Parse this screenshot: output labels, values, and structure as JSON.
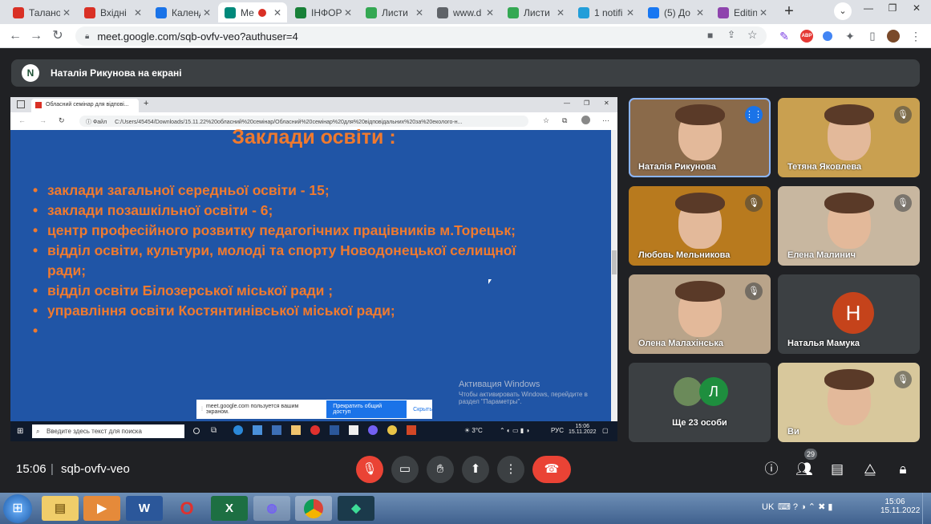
{
  "browser": {
    "tabs": [
      {
        "title": "Талано",
        "favicon": "gmail-icon",
        "color": "#d93025"
      },
      {
        "title": "Вхідні",
        "favicon": "gmail-icon",
        "color": "#d93025"
      },
      {
        "title": "Календ",
        "favicon": "calendar-icon",
        "color": "#1a73e8"
      },
      {
        "title": "Ме",
        "favicon": "meet-icon",
        "color": "#00897b"
      },
      {
        "title": "ІНФОР",
        "favicon": "sheets-icon",
        "color": "#188038"
      },
      {
        "title": "Листи",
        "favicon": "leaf-icon",
        "color": "#34a853"
      },
      {
        "title": "www.d",
        "favicon": "globe-icon",
        "color": "#5f6368"
      },
      {
        "title": "Листи",
        "favicon": "refresh-icon",
        "color": "#34a853"
      },
      {
        "title": "1 notifi",
        "favicon": "telegram-icon",
        "color": "#229ed9"
      },
      {
        "title": "(5) До",
        "favicon": "facebook-icon",
        "color": "#1877f2"
      },
      {
        "title": "Editing",
        "favicon": "editor-icon",
        "color": "#8e44ad"
      }
    ],
    "url": "meet.google.com/sqb-ovfv-veo?authuser=4"
  },
  "presentation": {
    "presenter_initial": "N",
    "text": "Наталія Рикунова на екрані"
  },
  "shared_screen": {
    "inner_tab": "Обласний семінар для відпові...",
    "file_label": "Файл",
    "file_path": "C:/Users/45454/Downloads/15.11.22%20обласний%20семінар/Обласний%20семінар%20для%20відповідальних%20за%20еколого-н...",
    "slide_title": "Заклади освіти :",
    "bullets": [
      "заклади загальної середньої освіти - 15;",
      "заклади позашкільної   освіти - 6;",
      "центр професійного розвитку педагогічних працівників м.Торецьк;",
      "відділ освіти, культури, молоді та спорту Новодонецької селищної",
      "ради;",
      "відділ освіти Білозерської міської ради ;",
      "управління освіти Костянтинівської міської ради;",
      ""
    ],
    "activate_title": "Активация Windows",
    "activate_text": "Чтобы активировать Windows, перейдите в раздел \"Параметры\".",
    "share_notice": "meet.google.com пользуется вашим экраном.",
    "share_stop": "Прекратить общий доступ",
    "share_hide": "Скрыть",
    "taskbar_search": "Введите здесь текст для поиска",
    "temp": "3°C",
    "lang": "РУС",
    "clock_time": "15:06",
    "clock_date": "15.11.2022"
  },
  "participants": [
    {
      "name": "Наталія Рикунова",
      "speaking": true,
      "muted": false,
      "bg": "#8a6a4a"
    },
    {
      "name": "Тетяна Яковлева",
      "speaking": false,
      "muted": true,
      "bg": "#c9a050"
    },
    {
      "name": "Любовь Мельникова",
      "speaking": false,
      "muted": true,
      "bg": "#b87a1e"
    },
    {
      "name": "Елена Малинич",
      "speaking": false,
      "muted": true,
      "bg": "#c8b7a0"
    },
    {
      "name": "Олена Малахінська",
      "speaking": false,
      "muted": true,
      "bg": "#b9a48a"
    },
    {
      "name": "Наталья Мамука",
      "speaking": false,
      "muted": false,
      "bg": "#3c4043",
      "avatar": "H",
      "avatar_color": "#c5431b"
    },
    {
      "name": "Ще 23 особи",
      "speaking": false,
      "muted": false,
      "bg": "#3c4043",
      "avatar": "Л",
      "avatar_color": "#1e8e3e"
    },
    {
      "name": "Ви",
      "speaking": false,
      "muted": true,
      "bg": "#d8c89c"
    }
  ],
  "meeting": {
    "time": "15:06",
    "code": "sqb-ovfv-veo",
    "people_count": "29"
  },
  "taskbar": {
    "lang": "UK",
    "time": "15:06",
    "date": "15.11.2022"
  }
}
